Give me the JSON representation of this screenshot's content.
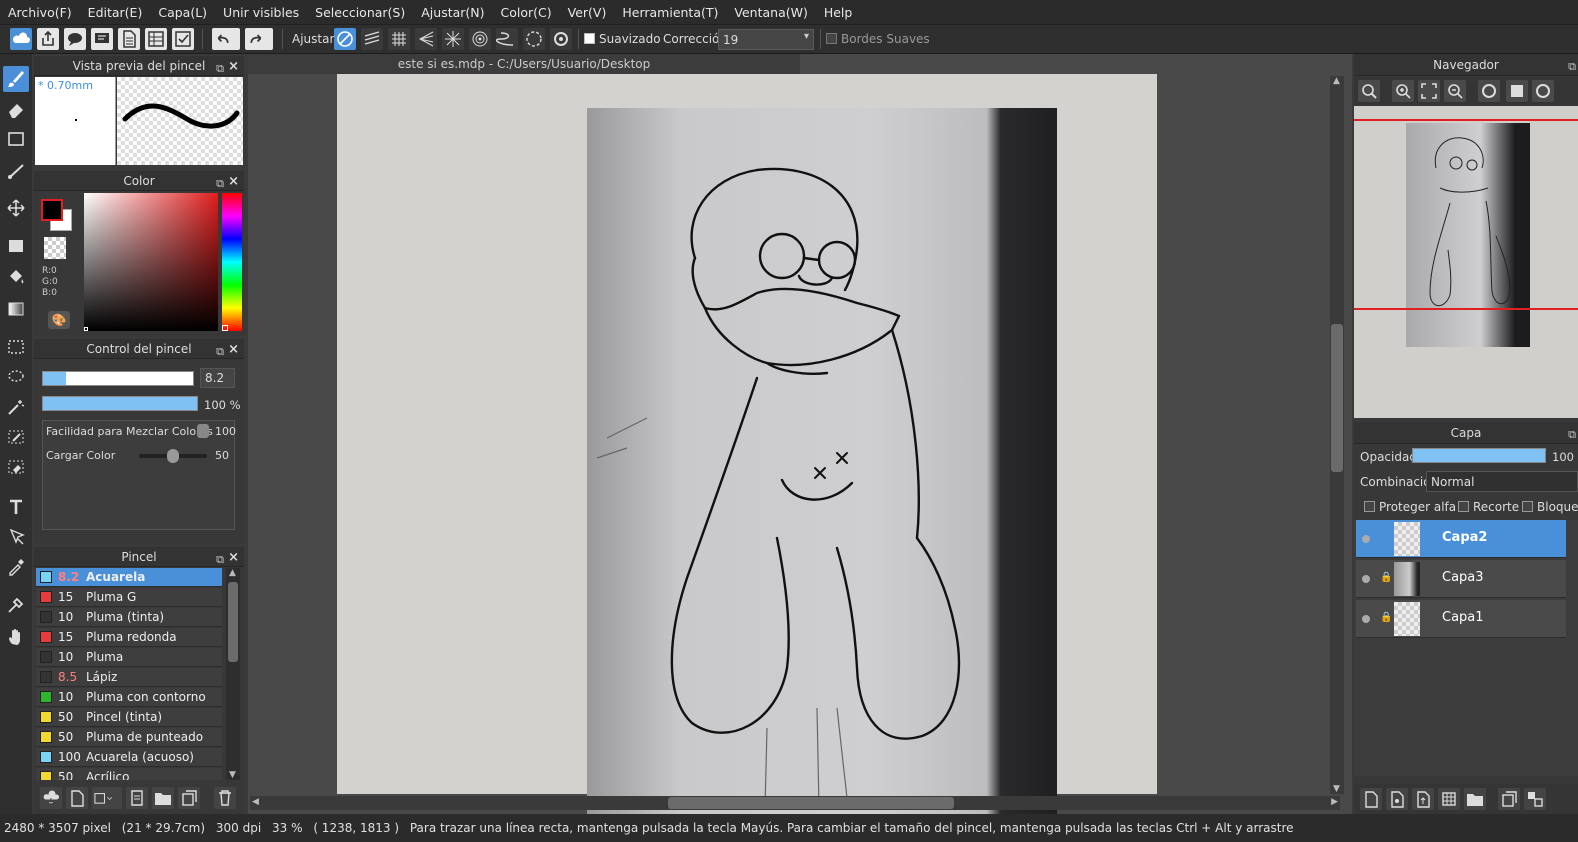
{
  "menu": [
    "Archivo(F)",
    "Editar(E)",
    "Capa(L)",
    "Unir visibles",
    "Seleccionar(S)",
    "Ajustar(N)",
    "Color(C)",
    "Ver(V)",
    "Herramienta(T)",
    "Ventana(W)",
    "Help"
  ],
  "toolbar": {
    "adjust_label": "Ajustar",
    "smoothing_label": "Suavizado",
    "correction_label": "Corrección",
    "correction_value": "19",
    "soft_edges_label": "Bordes Suaves"
  },
  "brush_preview": {
    "title": "Vista previa del pincel",
    "size": "* 0.70mm"
  },
  "color_panel": {
    "title": "Color",
    "r": "R:0",
    "g": "G:0",
    "b": "B:0",
    "fg": "#000000",
    "bg": "#ffffff"
  },
  "brush_control": {
    "title": "Control del pincel",
    "size_value": "8.2",
    "opacity_value": "100 %",
    "mix_label": "Facilidad para Mezclar Colores",
    "mix_value": "100",
    "load_label": "Cargar Color",
    "load_value": "50",
    "load_level": 0.5,
    "size_level": 0.15
  },
  "brush_panel": {
    "title": "Pincel",
    "items": [
      {
        "size": "8.2",
        "name": "Acuarela",
        "color": "#7ad4f5",
        "selected": true,
        "size_red": true
      },
      {
        "size": "15",
        "name": "Pluma G",
        "color": "#e83b3b"
      },
      {
        "size": "10",
        "name": "Pluma (tinta)",
        "color": "#333333"
      },
      {
        "size": "15",
        "name": "Pluma redonda",
        "color": "#e83b3b"
      },
      {
        "size": "10",
        "name": "Pluma",
        "color": "#333333"
      },
      {
        "size": "8.5",
        "name": "Lápiz",
        "color": "#333333",
        "size_red": true
      },
      {
        "size": "10",
        "name": "Pluma con contorno",
        "color": "#2db52d"
      },
      {
        "size": "50",
        "name": "Pincel (tinta)",
        "color": "#f0d830"
      },
      {
        "size": "50",
        "name": "Pluma de punteado",
        "color": "#f0d830"
      },
      {
        "size": "100",
        "name": "Acuarela (acuoso)",
        "color": "#7ad4f5"
      },
      {
        "size": "50",
        "name": "Acrílico",
        "color": "#f0d830"
      }
    ]
  },
  "document": {
    "tab_title": "este si es.mdp - C:/Users/Usuario/Desktop"
  },
  "navigator": {
    "title": "Navegador"
  },
  "layer_panel": {
    "title": "Capa",
    "opacity_label": "Opacidad",
    "opacity_value": "100",
    "blend_label": "Combinación",
    "blend_value": "Normal",
    "protect_alpha": "Proteger alfa",
    "clipping": "Recorte",
    "lock": "Bloque",
    "layers": [
      {
        "name": "Capa2",
        "selected": true,
        "locked": false
      },
      {
        "name": "Capa3",
        "selected": false,
        "locked": true
      },
      {
        "name": "Capa1",
        "selected": false,
        "locked": true
      }
    ]
  },
  "status": {
    "dimensions": "2480 * 3507 pixel",
    "physical": "(21 * 29.7cm)",
    "dpi": "300 dpi",
    "zoom": "33 %",
    "coords": "( 1238, 1813 )",
    "hint": "Para trazar una línea recta, mantenga pulsada la tecla Mayús. Para cambiar el tamaño del pincel, mantenga pulsada las teclas Ctrl + Alt y arrastre"
  },
  "colors": {
    "accent": "#4a90d9",
    "nav_frame": "#e02020"
  }
}
